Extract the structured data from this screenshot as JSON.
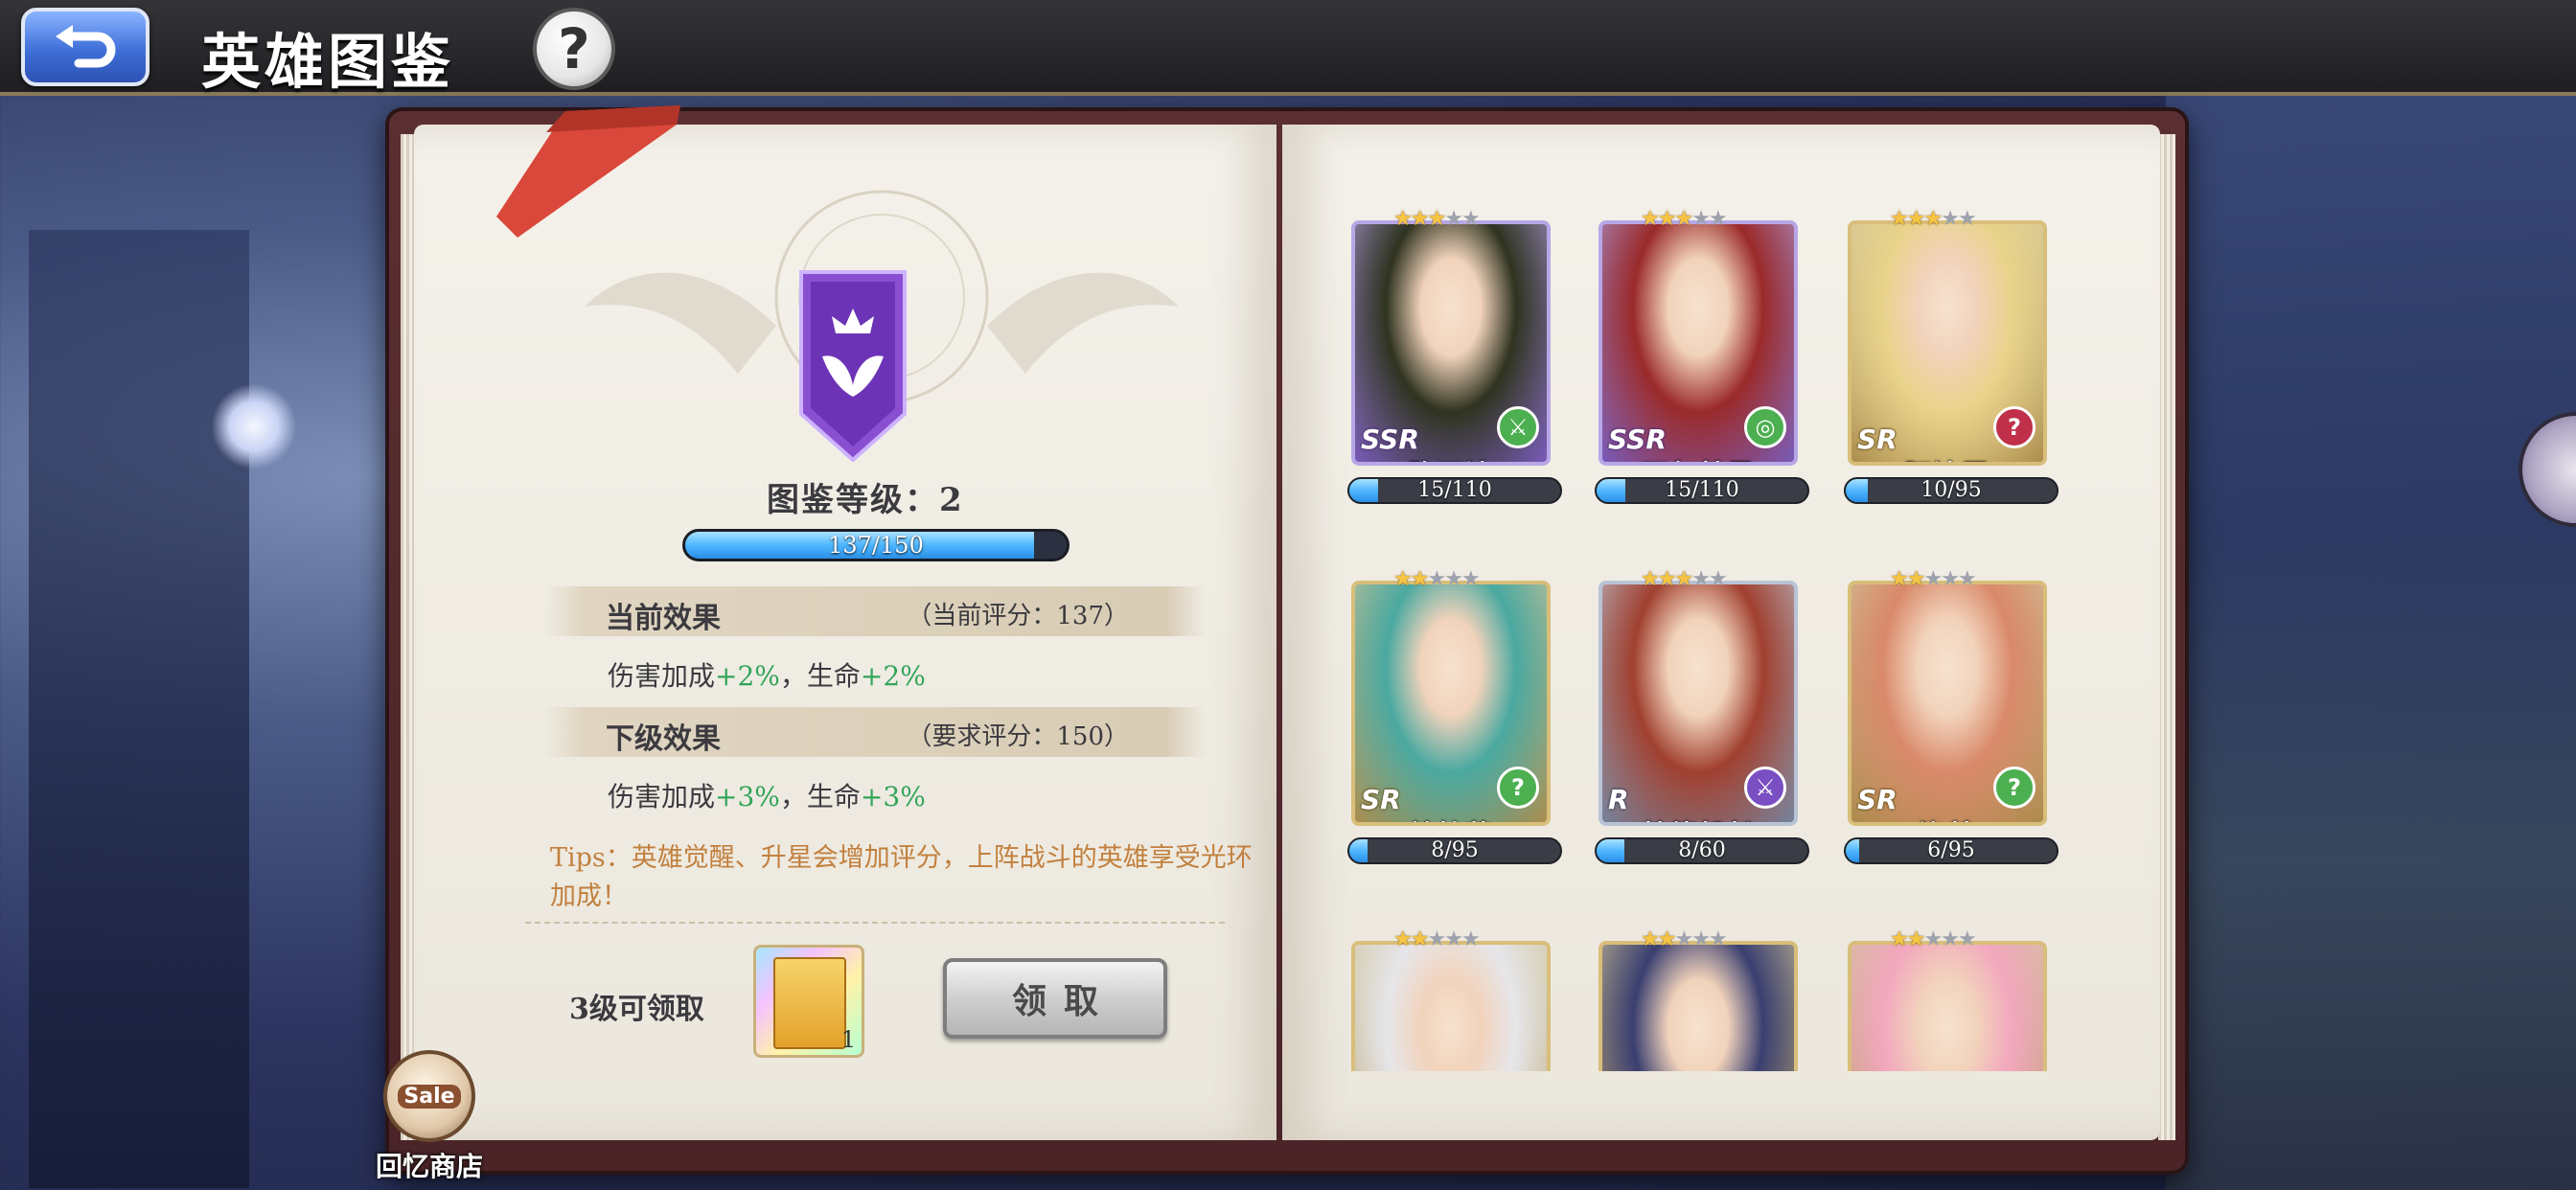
{
  "header": {
    "title": "英雄图鉴",
    "help_label": "?"
  },
  "left_page": {
    "level_label": "图鉴等级：2",
    "progress": {
      "text": "137/150",
      "value": 137,
      "max": 150
    },
    "current_effect": {
      "label": "当前效果",
      "score_text": "（当前评分：137）",
      "line_prefix": "伤害加成",
      "dmg": "+2%",
      "sep": "，生命",
      "hp": "+2%"
    },
    "next_effect": {
      "label": "下级效果",
      "score_text": "（要求评分：150）",
      "line_prefix": "伤害加成",
      "dmg": "+3%",
      "sep": "，生命",
      "hp": "+3%"
    },
    "tips": "Tips：英雄觉醒、升星会增加评分，上阵战斗的英雄享受光环加成！",
    "reward": {
      "label": "3级可领取",
      "count": "1"
    },
    "claim_label": "领取"
  },
  "shop": {
    "badge": "Sale",
    "label": "回忆商店"
  },
  "heroes": [
    {
      "name": "路西法",
      "rarity": "SSR",
      "stars": 3,
      "progress_text": "15/110",
      "value": 15,
      "max": 110,
      "class_icon": "⚔",
      "class_color": "#4caf50",
      "tier": "ssr",
      "tone": "#2f3320"
    },
    {
      "name": "瓦尔基里",
      "rarity": "SSR",
      "stars": 3,
      "progress_text": "15/110",
      "value": 15,
      "max": 110,
      "class_icon": "◎",
      "class_color": "#4caf50",
      "tier": "ssr",
      "tone": "#9a2a2a"
    },
    {
      "name": "阿波罗",
      "rarity": "SR",
      "stars": 3,
      "progress_text": "10/95",
      "value": 10,
      "max": 95,
      "class_icon": "?",
      "class_color": "#c0304a",
      "tier": "sr",
      "tone": "#e9d38a"
    },
    {
      "name": "美杜莎",
      "rarity": "SR",
      "stars": 2,
      "progress_text": "8/95",
      "value": 8,
      "max": 95,
      "class_icon": "?",
      "class_color": "#4caf50",
      "tier": "sr",
      "tone": "#4aa9a0"
    },
    {
      "name": "基德船长",
      "rarity": "R",
      "stars": 3,
      "progress_text": "8/60",
      "value": 8,
      "max": 60,
      "class_icon": "⚔",
      "class_color": "#7a4fc2",
      "tier": "r",
      "tone": "#a04030"
    },
    {
      "name": "洛基",
      "rarity": "SR",
      "stars": 2,
      "progress_text": "6/95",
      "value": 6,
      "max": 95,
      "class_icon": "?",
      "class_color": "#4caf50",
      "tier": "sr",
      "tone": "#d9896a"
    },
    {
      "name": "",
      "rarity": "",
      "stars": 2,
      "progress_text": "",
      "tier": "sr",
      "tone": "#e6e6ea"
    },
    {
      "name": "",
      "rarity": "",
      "stars": 2,
      "progress_text": "",
      "tier": "sr",
      "tone": "#3a3f70"
    },
    {
      "name": "",
      "rarity": "",
      "stars": 2,
      "progress_text": "",
      "tier": "sr",
      "tone": "#f2a7be"
    }
  ],
  "colors": {
    "accent_green": "#33a55a",
    "tips_orange": "#c2803e",
    "progress_blue": "#4eb6ff"
  }
}
